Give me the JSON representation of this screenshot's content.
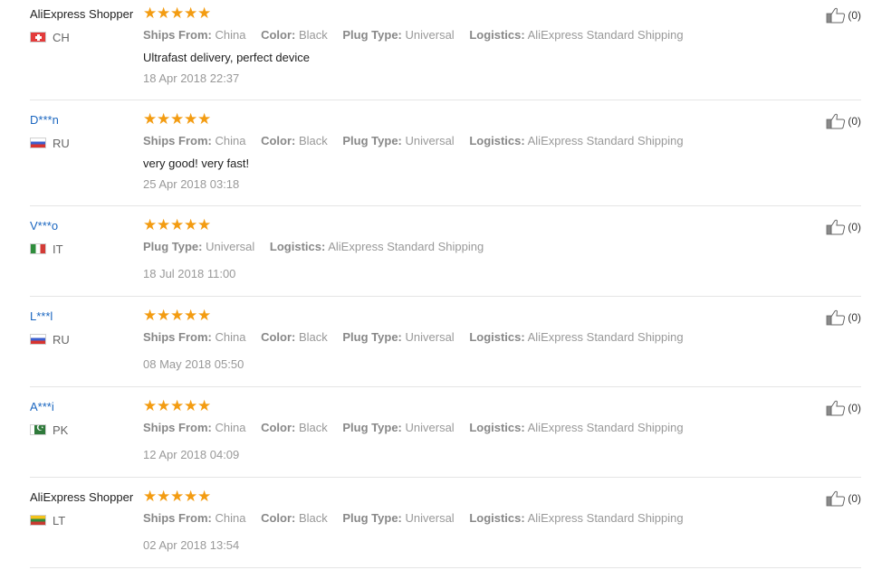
{
  "icons": {
    "rating": "star-icon",
    "helpful": "thumbs-up-icon"
  },
  "colors": {
    "stars": "#f39c12",
    "buyer_link": "#1a66c0",
    "muted": "#999999"
  },
  "reviews": [
    {
      "buyer": "AliExpress Shopper",
      "country": "CH",
      "stars": [
        "★",
        "★",
        "★",
        "★",
        "★"
      ],
      "attrs": [
        {
          "label": "Ships From:",
          "value": "China"
        },
        {
          "label": "Color:",
          "value": "Black"
        },
        {
          "label": "Plug Type:",
          "value": "Universal"
        },
        {
          "label": "Logistics:",
          "value": "AliExpress Standard Shipping"
        }
      ],
      "text": "Ultrafast delivery, perfect device",
      "date": "18 Apr 2018 22:37",
      "helpful": "(0)"
    },
    {
      "buyer": "D***n",
      "country": "RU",
      "stars": [
        "★",
        "★",
        "★",
        "★",
        "★"
      ],
      "attrs": [
        {
          "label": "Ships From:",
          "value": "China"
        },
        {
          "label": "Color:",
          "value": "Black"
        },
        {
          "label": "Plug Type:",
          "value": "Universal"
        },
        {
          "label": "Logistics:",
          "value": "AliExpress Standard Shipping"
        }
      ],
      "text": "very good! very fast!",
      "date": "25 Apr 2018 03:18",
      "helpful": "(0)"
    },
    {
      "buyer": "V***o",
      "country": "IT",
      "stars": [
        "★",
        "★",
        "★",
        "★",
        "★"
      ],
      "attrs": [
        {
          "label": "Plug Type:",
          "value": "Universal"
        },
        {
          "label": "Logistics:",
          "value": "AliExpress Standard Shipping"
        }
      ],
      "date": "18 Jul 2018 11:00",
      "helpful": "(0)"
    },
    {
      "buyer": "L***l",
      "country": "RU",
      "stars": [
        "★",
        "★",
        "★",
        "★",
        "★"
      ],
      "attrs": [
        {
          "label": "Ships From:",
          "value": "China"
        },
        {
          "label": "Color:",
          "value": "Black"
        },
        {
          "label": "Plug Type:",
          "value": "Universal"
        },
        {
          "label": "Logistics:",
          "value": "AliExpress Standard Shipping"
        }
      ],
      "date": "08 May 2018 05:50",
      "helpful": "(0)"
    },
    {
      "buyer": "A***i",
      "country": "PK",
      "stars": [
        "★",
        "★",
        "★",
        "★",
        "★"
      ],
      "attrs": [
        {
          "label": "Ships From:",
          "value": "China"
        },
        {
          "label": "Color:",
          "value": "Black"
        },
        {
          "label": "Plug Type:",
          "value": "Universal"
        },
        {
          "label": "Logistics:",
          "value": "AliExpress Standard Shipping"
        }
      ],
      "date": "12 Apr 2018 04:09",
      "helpful": "(0)"
    },
    {
      "buyer": "AliExpress Shopper",
      "country": "LT",
      "stars": [
        "★",
        "★",
        "★",
        "★",
        "★"
      ],
      "attrs": [
        {
          "label": "Ships From:",
          "value": "China"
        },
        {
          "label": "Color:",
          "value": "Black"
        },
        {
          "label": "Plug Type:",
          "value": "Universal"
        },
        {
          "label": "Logistics:",
          "value": "AliExpress Standard Shipping"
        }
      ],
      "date": "02 Apr 2018 13:54",
      "helpful": "(0)"
    }
  ]
}
